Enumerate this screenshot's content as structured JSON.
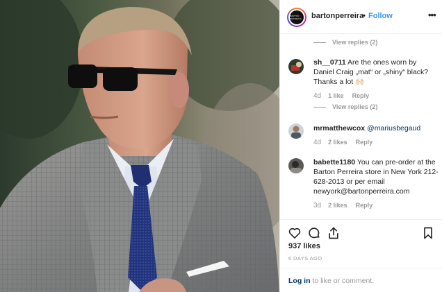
{
  "header": {
    "avatar_text": "BARTON PERREIRA",
    "username": "bartonperreira",
    "separator": "•",
    "follow_label": "Follow",
    "more_icon": "more-horizontal-icon",
    "more_label": "•••"
  },
  "comments": {
    "top_view_replies": "View replies (2)",
    "items": [
      {
        "username": "sh__0711",
        "text": " Are the ones worn by Daniel Craig „mat“ or „shiny“ black? Thanks a lot 🙌🏻",
        "age": "4d",
        "likes": "1 like",
        "reply_label": "Reply",
        "view_replies": "View replies (2)"
      },
      {
        "username": "mrmatthewcox",
        "mention": "@mariusbegaud",
        "age": "4d",
        "likes": "2 likes",
        "reply_label": "Reply"
      },
      {
        "username": "babette1180",
        "text": " You can pre-order at the Barton Perreira store in New York 212-628-2013 or per email newyork@bartonperreira.com",
        "age": "3d",
        "likes": "2 likes",
        "reply_label": "Reply"
      }
    ]
  },
  "actions": {
    "icons": [
      "heart-icon",
      "comment-icon",
      "share-icon",
      "bookmark-icon"
    ],
    "likes_count": "937 likes",
    "date": "6 DAYS AGO"
  },
  "login": {
    "link_label": "Log in",
    "rest": " to like or comment."
  },
  "colors": {
    "link_blue": "#3897f0",
    "mention_blue": "#003569",
    "muted": "#999999",
    "border": "#efefef"
  }
}
